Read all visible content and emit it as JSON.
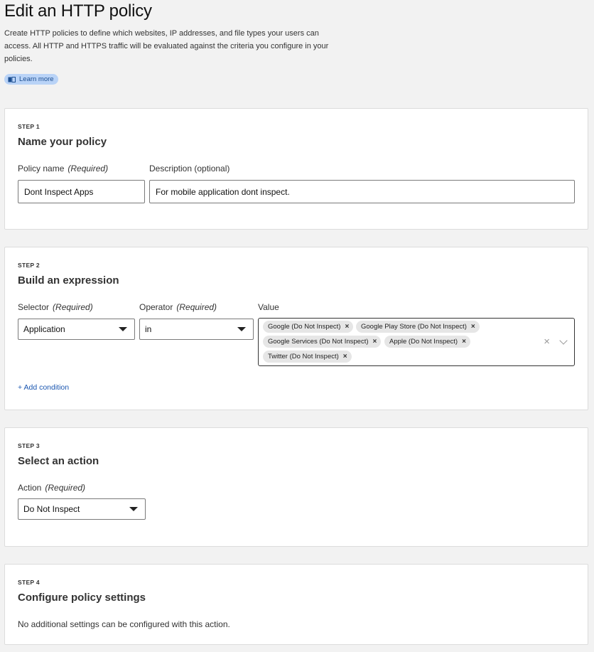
{
  "header": {
    "title": "Edit an HTTP policy",
    "description": "Create HTTP policies to define which websites, IP addresses, and file types your users can access. All HTTP and HTTPS traffic will be evaluated against the criteria you configure in your policies.",
    "learn_more": "Learn more",
    "learn_more_icon": "book-icon"
  },
  "step1": {
    "label": "STEP 1",
    "title": "Name your policy",
    "policy_name_label": "Policy name",
    "policy_name_req": "(Required)",
    "policy_name_value": "Dont Inspect Apps",
    "description_label": "Description (optional)",
    "description_value": "For mobile application dont inspect."
  },
  "step2": {
    "label": "STEP 2",
    "title": "Build an expression",
    "selector_label": "Selector",
    "selector_req": "(Required)",
    "selector_value": "Application",
    "operator_label": "Operator",
    "operator_req": "(Required)",
    "operator_value": "in",
    "value_label": "Value",
    "value_tags": [
      "Google (Do Not Inspect)",
      "Google Play Store (Do Not Inspect)",
      "Google Services (Do Not Inspect)",
      "Apple (Do Not Inspect)",
      "Twitter (Do Not Inspect)"
    ],
    "tag_remove": "×",
    "clear_all": "×",
    "add_condition": "+ Add condition"
  },
  "step3": {
    "label": "STEP 3",
    "title": "Select an action",
    "action_label": "Action",
    "action_req": "(Required)",
    "action_value": "Do Not Inspect"
  },
  "step4": {
    "label": "STEP 4",
    "title": "Configure policy settings",
    "info": "No additional settings can be configured with this action."
  },
  "colors": {
    "background": "#f2f2f2",
    "link": "#1a56b0",
    "learn_more_bg": "#b9d3f7"
  }
}
